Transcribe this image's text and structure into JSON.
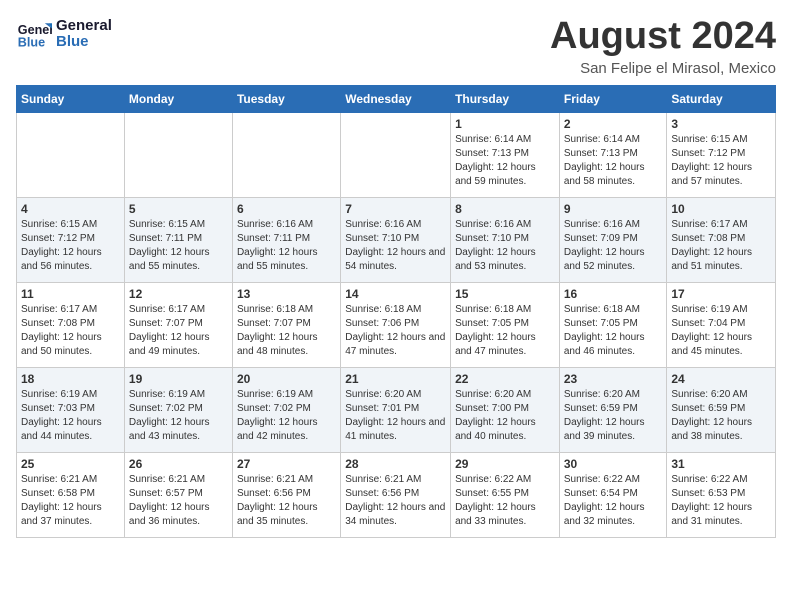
{
  "logo": {
    "line1": "General",
    "line2": "Blue"
  },
  "header": {
    "month": "August 2024",
    "location": "San Felipe el Mirasol, Mexico"
  },
  "weekdays": [
    "Sunday",
    "Monday",
    "Tuesday",
    "Wednesday",
    "Thursday",
    "Friday",
    "Saturday"
  ],
  "weeks": [
    [
      {
        "day": "",
        "sunrise": "",
        "sunset": "",
        "daylight": ""
      },
      {
        "day": "",
        "sunrise": "",
        "sunset": "",
        "daylight": ""
      },
      {
        "day": "",
        "sunrise": "",
        "sunset": "",
        "daylight": ""
      },
      {
        "day": "",
        "sunrise": "",
        "sunset": "",
        "daylight": ""
      },
      {
        "day": "1",
        "sunrise": "Sunrise: 6:14 AM",
        "sunset": "Sunset: 7:13 PM",
        "daylight": "Daylight: 12 hours and 59 minutes."
      },
      {
        "day": "2",
        "sunrise": "Sunrise: 6:14 AM",
        "sunset": "Sunset: 7:13 PM",
        "daylight": "Daylight: 12 hours and 58 minutes."
      },
      {
        "day": "3",
        "sunrise": "Sunrise: 6:15 AM",
        "sunset": "Sunset: 7:12 PM",
        "daylight": "Daylight: 12 hours and 57 minutes."
      }
    ],
    [
      {
        "day": "4",
        "sunrise": "Sunrise: 6:15 AM",
        "sunset": "Sunset: 7:12 PM",
        "daylight": "Daylight: 12 hours and 56 minutes."
      },
      {
        "day": "5",
        "sunrise": "Sunrise: 6:15 AM",
        "sunset": "Sunset: 7:11 PM",
        "daylight": "Daylight: 12 hours and 55 minutes."
      },
      {
        "day": "6",
        "sunrise": "Sunrise: 6:16 AM",
        "sunset": "Sunset: 7:11 PM",
        "daylight": "Daylight: 12 hours and 55 minutes."
      },
      {
        "day": "7",
        "sunrise": "Sunrise: 6:16 AM",
        "sunset": "Sunset: 7:10 PM",
        "daylight": "Daylight: 12 hours and 54 minutes."
      },
      {
        "day": "8",
        "sunrise": "Sunrise: 6:16 AM",
        "sunset": "Sunset: 7:10 PM",
        "daylight": "Daylight: 12 hours and 53 minutes."
      },
      {
        "day": "9",
        "sunrise": "Sunrise: 6:16 AM",
        "sunset": "Sunset: 7:09 PM",
        "daylight": "Daylight: 12 hours and 52 minutes."
      },
      {
        "day": "10",
        "sunrise": "Sunrise: 6:17 AM",
        "sunset": "Sunset: 7:08 PM",
        "daylight": "Daylight: 12 hours and 51 minutes."
      }
    ],
    [
      {
        "day": "11",
        "sunrise": "Sunrise: 6:17 AM",
        "sunset": "Sunset: 7:08 PM",
        "daylight": "Daylight: 12 hours and 50 minutes."
      },
      {
        "day": "12",
        "sunrise": "Sunrise: 6:17 AM",
        "sunset": "Sunset: 7:07 PM",
        "daylight": "Daylight: 12 hours and 49 minutes."
      },
      {
        "day": "13",
        "sunrise": "Sunrise: 6:18 AM",
        "sunset": "Sunset: 7:07 PM",
        "daylight": "Daylight: 12 hours and 48 minutes."
      },
      {
        "day": "14",
        "sunrise": "Sunrise: 6:18 AM",
        "sunset": "Sunset: 7:06 PM",
        "daylight": "Daylight: 12 hours and 47 minutes."
      },
      {
        "day": "15",
        "sunrise": "Sunrise: 6:18 AM",
        "sunset": "Sunset: 7:05 PM",
        "daylight": "Daylight: 12 hours and 47 minutes."
      },
      {
        "day": "16",
        "sunrise": "Sunrise: 6:18 AM",
        "sunset": "Sunset: 7:05 PM",
        "daylight": "Daylight: 12 hours and 46 minutes."
      },
      {
        "day": "17",
        "sunrise": "Sunrise: 6:19 AM",
        "sunset": "Sunset: 7:04 PM",
        "daylight": "Daylight: 12 hours and 45 minutes."
      }
    ],
    [
      {
        "day": "18",
        "sunrise": "Sunrise: 6:19 AM",
        "sunset": "Sunset: 7:03 PM",
        "daylight": "Daylight: 12 hours and 44 minutes."
      },
      {
        "day": "19",
        "sunrise": "Sunrise: 6:19 AM",
        "sunset": "Sunset: 7:02 PM",
        "daylight": "Daylight: 12 hours and 43 minutes."
      },
      {
        "day": "20",
        "sunrise": "Sunrise: 6:19 AM",
        "sunset": "Sunset: 7:02 PM",
        "daylight": "Daylight: 12 hours and 42 minutes."
      },
      {
        "day": "21",
        "sunrise": "Sunrise: 6:20 AM",
        "sunset": "Sunset: 7:01 PM",
        "daylight": "Daylight: 12 hours and 41 minutes."
      },
      {
        "day": "22",
        "sunrise": "Sunrise: 6:20 AM",
        "sunset": "Sunset: 7:00 PM",
        "daylight": "Daylight: 12 hours and 40 minutes."
      },
      {
        "day": "23",
        "sunrise": "Sunrise: 6:20 AM",
        "sunset": "Sunset: 6:59 PM",
        "daylight": "Daylight: 12 hours and 39 minutes."
      },
      {
        "day": "24",
        "sunrise": "Sunrise: 6:20 AM",
        "sunset": "Sunset: 6:59 PM",
        "daylight": "Daylight: 12 hours and 38 minutes."
      }
    ],
    [
      {
        "day": "25",
        "sunrise": "Sunrise: 6:21 AM",
        "sunset": "Sunset: 6:58 PM",
        "daylight": "Daylight: 12 hours and 37 minutes."
      },
      {
        "day": "26",
        "sunrise": "Sunrise: 6:21 AM",
        "sunset": "Sunset: 6:57 PM",
        "daylight": "Daylight: 12 hours and 36 minutes."
      },
      {
        "day": "27",
        "sunrise": "Sunrise: 6:21 AM",
        "sunset": "Sunset: 6:56 PM",
        "daylight": "Daylight: 12 hours and 35 minutes."
      },
      {
        "day": "28",
        "sunrise": "Sunrise: 6:21 AM",
        "sunset": "Sunset: 6:56 PM",
        "daylight": "Daylight: 12 hours and 34 minutes."
      },
      {
        "day": "29",
        "sunrise": "Sunrise: 6:22 AM",
        "sunset": "Sunset: 6:55 PM",
        "daylight": "Daylight: 12 hours and 33 minutes."
      },
      {
        "day": "30",
        "sunrise": "Sunrise: 6:22 AM",
        "sunset": "Sunset: 6:54 PM",
        "daylight": "Daylight: 12 hours and 32 minutes."
      },
      {
        "day": "31",
        "sunrise": "Sunrise: 6:22 AM",
        "sunset": "Sunset: 6:53 PM",
        "daylight": "Daylight: 12 hours and 31 minutes."
      }
    ]
  ]
}
